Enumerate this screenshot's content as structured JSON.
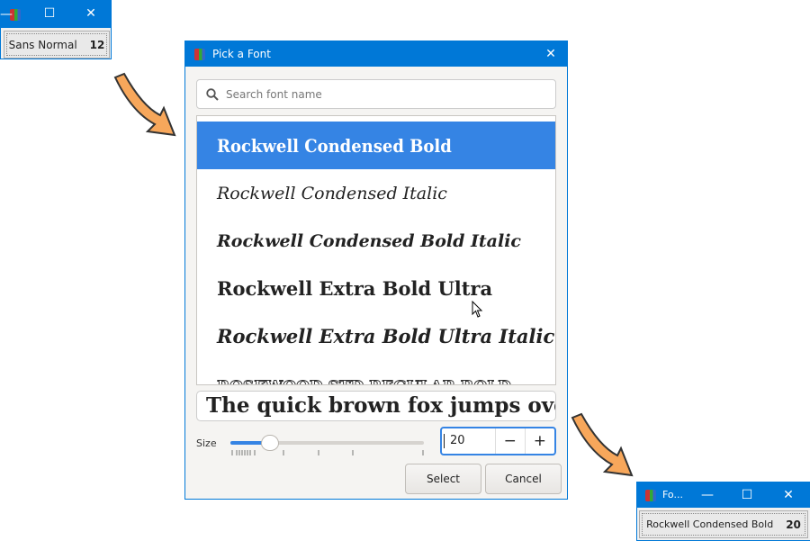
{
  "main_window": {
    "title_controls": [
      "minimize",
      "maximize",
      "close"
    ],
    "button": {
      "font_name": "Sans Normal",
      "size": "12"
    }
  },
  "dialog": {
    "title": "Pick a Font",
    "search_placeholder": "Search font name",
    "fonts": [
      "Rockwell Condensed Bold",
      "Rockwell Condensed Italic",
      "Rockwell Condensed Bold Italic",
      "Rockwell Extra Bold Ultra",
      "Rockwell Extra Bold Ultra Italic",
      "Rosewood Std Regular Bold"
    ],
    "selected_index": 0,
    "preview_text": "The quick brown fox jumps over the lazy dog",
    "size_label": "Size",
    "size_value": "20",
    "minus": "−",
    "plus": "+",
    "select_label": "Select",
    "cancel_label": "Cancel",
    "accent": "#3584e4"
  },
  "result_window": {
    "title": "Fo...",
    "button": {
      "font_name": "Rockwell Condensed Bold",
      "size": "20"
    }
  },
  "arrow_color": "#f7a75b"
}
